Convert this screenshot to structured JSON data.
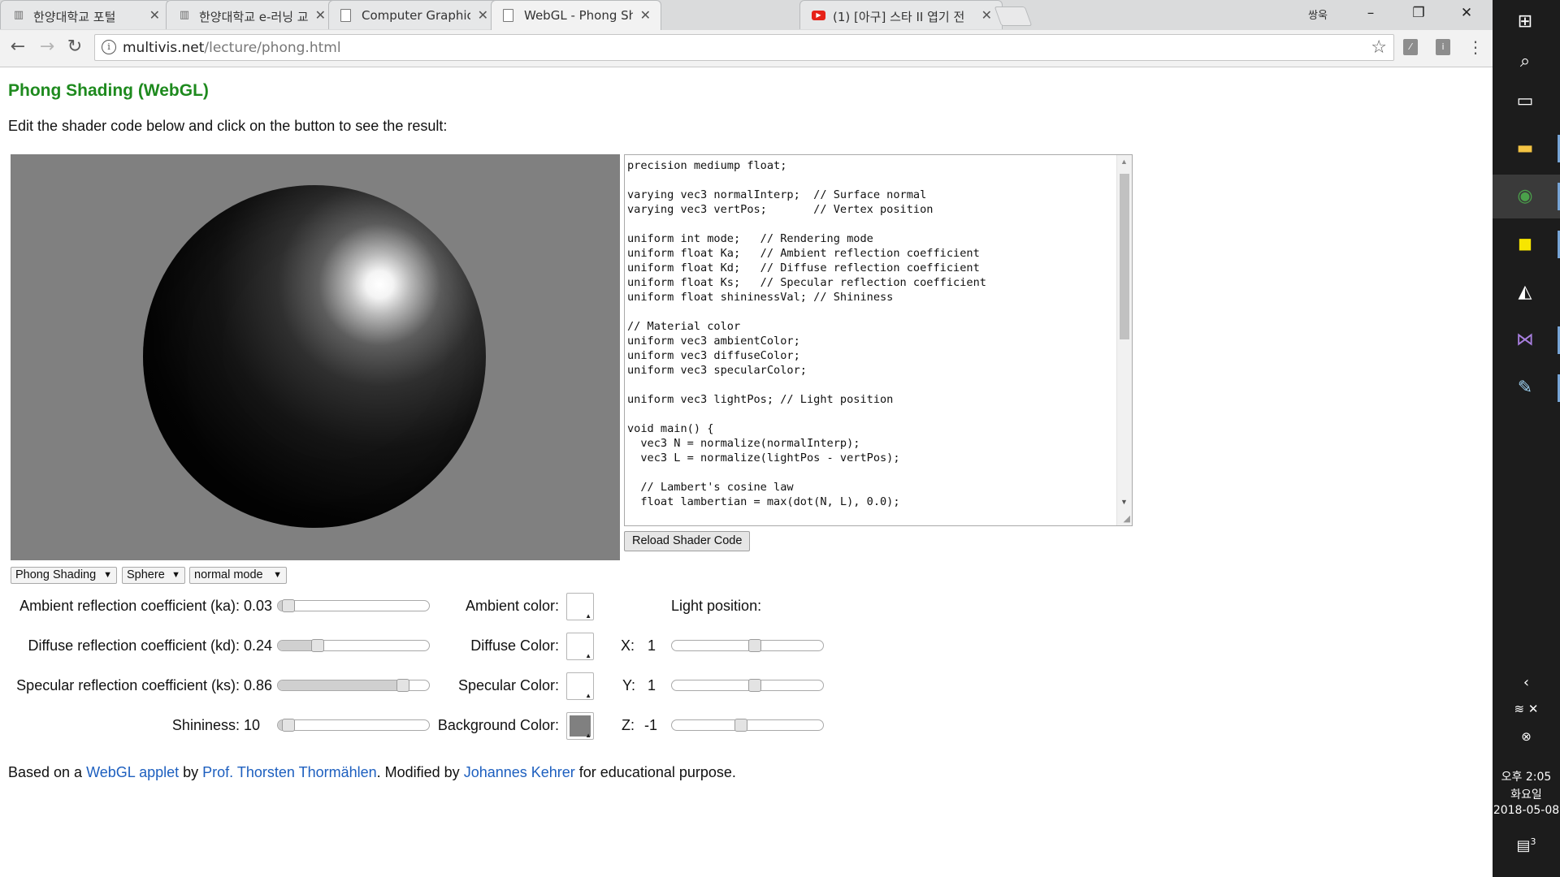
{
  "browser": {
    "tabs": [
      {
        "label": "한양대학교 포털",
        "favicon": "bar-chart-icon",
        "active": false
      },
      {
        "label": "한양대학교 e-러닝 교육",
        "favicon": "bar-chart-icon",
        "active": false
      },
      {
        "label": "Computer Graphics",
        "favicon": "document-icon",
        "active": false
      },
      {
        "label": "WebGL - Phong Shading",
        "favicon": "document-icon",
        "active": true
      },
      {
        "label": "(1) [아구] 스타 II 엽기 전",
        "favicon": "youtube-icon",
        "active": false
      }
    ],
    "user_badge": "쌍욱",
    "address": {
      "domain": "multivis.net",
      "path": "/lecture/phong.html"
    }
  },
  "page": {
    "title": "Phong Shading (WebGL)",
    "intro": "Edit the shader code below and click on the button to see the result:",
    "shader_code": "precision mediump float;\n\nvarying vec3 normalInterp;  // Surface normal\nvarying vec3 vertPos;       // Vertex position\n\nuniform int mode;   // Rendering mode\nuniform float Ka;   // Ambient reflection coefficient\nuniform float Kd;   // Diffuse reflection coefficient\nuniform float Ks;   // Specular reflection coefficient\nuniform float shininessVal; // Shininess\n\n// Material color\nuniform vec3 ambientColor;\nuniform vec3 diffuseColor;\nuniform vec3 specularColor;\n\nuniform vec3 lightPos; // Light position\n\nvoid main() {\n  vec3 N = normalize(normalInterp);\n  vec3 L = normalize(lightPos - vertPos);\n\n  // Lambert's cosine law\n  float lambertian = max(dot(N, L), 0.0);",
    "reload_button": "Reload Shader Code",
    "selects": {
      "shading": "Phong Shading",
      "model": "Sphere",
      "mode": "normal mode"
    },
    "controls": {
      "ka": {
        "label": "Ambient reflection coefficient (ka): 0.03",
        "level": 0.03
      },
      "kd": {
        "label": "Diffuse reflection coefficient (kd): 0.24",
        "level": 0.24
      },
      "ks": {
        "label": "Specular reflection coefficient (ks): 0.86",
        "level": 0.86
      },
      "shininess": {
        "label": "Shininess: 10",
        "level": 0.03
      }
    },
    "colors": {
      "ambient": {
        "label": "Ambient color:",
        "value": "#ffffff"
      },
      "diffuse": {
        "label": "Diffuse Color:",
        "value": "#ffffff"
      },
      "specular": {
        "label": "Specular Color:",
        "value": "#ffffff"
      },
      "background": {
        "label": "Background Color:",
        "value": "#808080"
      }
    },
    "light": {
      "label": "Light position:",
      "x": {
        "axis": "X:",
        "value": "1",
        "level": 0.55
      },
      "y": {
        "axis": "Y:",
        "value": "1",
        "level": 0.55
      },
      "z": {
        "axis": "Z:",
        "value": "-1",
        "level": 0.45
      }
    },
    "credits": {
      "prefix": "Based on a ",
      "link1": "WebGL applet",
      "mid1": " by ",
      "link2": "Prof. Thorsten Thormählen",
      "mid2": ". Modified by ",
      "link3": "Johannes Kehrer",
      "suffix": " for educational purpose."
    }
  },
  "taskbar": {
    "time": "오후 2:05",
    "weekday": "화요일",
    "date": "2018-05-08",
    "notification_count": "3",
    "apps": [
      "file-explorer-icon",
      "chrome-icon",
      "kakaotalk-icon",
      "unity-icon",
      "visual-studio-icon",
      "paint-icon"
    ]
  }
}
